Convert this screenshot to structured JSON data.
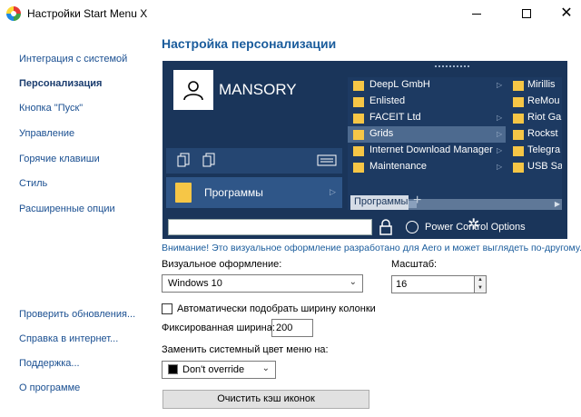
{
  "window": {
    "title": "Настройки Start Menu X",
    "close_glyph": "✕"
  },
  "sidebar": {
    "items": [
      {
        "label": "Интеграция с системой"
      },
      {
        "label": "Персонализация"
      },
      {
        "label": "Кнопка \"Пуск\""
      },
      {
        "label": "Управление"
      },
      {
        "label": "Горячие клавиши"
      },
      {
        "label": "Стиль"
      },
      {
        "label": "Расширенные опции"
      }
    ],
    "bottom_links": [
      {
        "label": "Проверить обновления..."
      },
      {
        "label": "Справка в интернет..."
      },
      {
        "label": "Поддержка..."
      },
      {
        "label": "О программе"
      }
    ]
  },
  "main": {
    "title": "Настройка персонализации",
    "preview": {
      "username": "MANSORY",
      "programs_label": "Программы",
      "menu_items": [
        {
          "label": "DeepL GmbH"
        },
        {
          "label": "Enlisted"
        },
        {
          "label": "FACEIT Ltd"
        },
        {
          "label": "Grids"
        },
        {
          "label": "Internet Download Manager"
        },
        {
          "label": "Maintenance"
        }
      ],
      "sub_items": [
        {
          "label": "Mirillis"
        },
        {
          "label": "ReMou"
        },
        {
          "label": "Riot Ga"
        },
        {
          "label": "Rockst"
        },
        {
          "label": "Telegra"
        },
        {
          "label": "USB Saf"
        }
      ],
      "tab_label": "Программы",
      "power_text": "Power Control Options"
    },
    "warning": "Внимание! Это визуальное оформление разработано для Aero и может выглядеть по-другому.",
    "visual_style": {
      "label": "Визуальное оформление:",
      "value": "Windows 10"
    },
    "scale": {
      "label": "Масштаб:",
      "value": "16"
    },
    "auto_width": {
      "label": "Автоматически подобрать ширину колонки",
      "checked": false
    },
    "fixed_width": {
      "label": "Фиксированная ширина:",
      "value": "200"
    },
    "system_color": {
      "label": "Заменить системный цвет меню на:",
      "value": "Don't override",
      "swatch": "#000000"
    },
    "clear_cache_button": "Очистить кэш иконок"
  },
  "colors": {
    "accent": "#1a5c9c",
    "preview_bg": "#1a355a"
  }
}
